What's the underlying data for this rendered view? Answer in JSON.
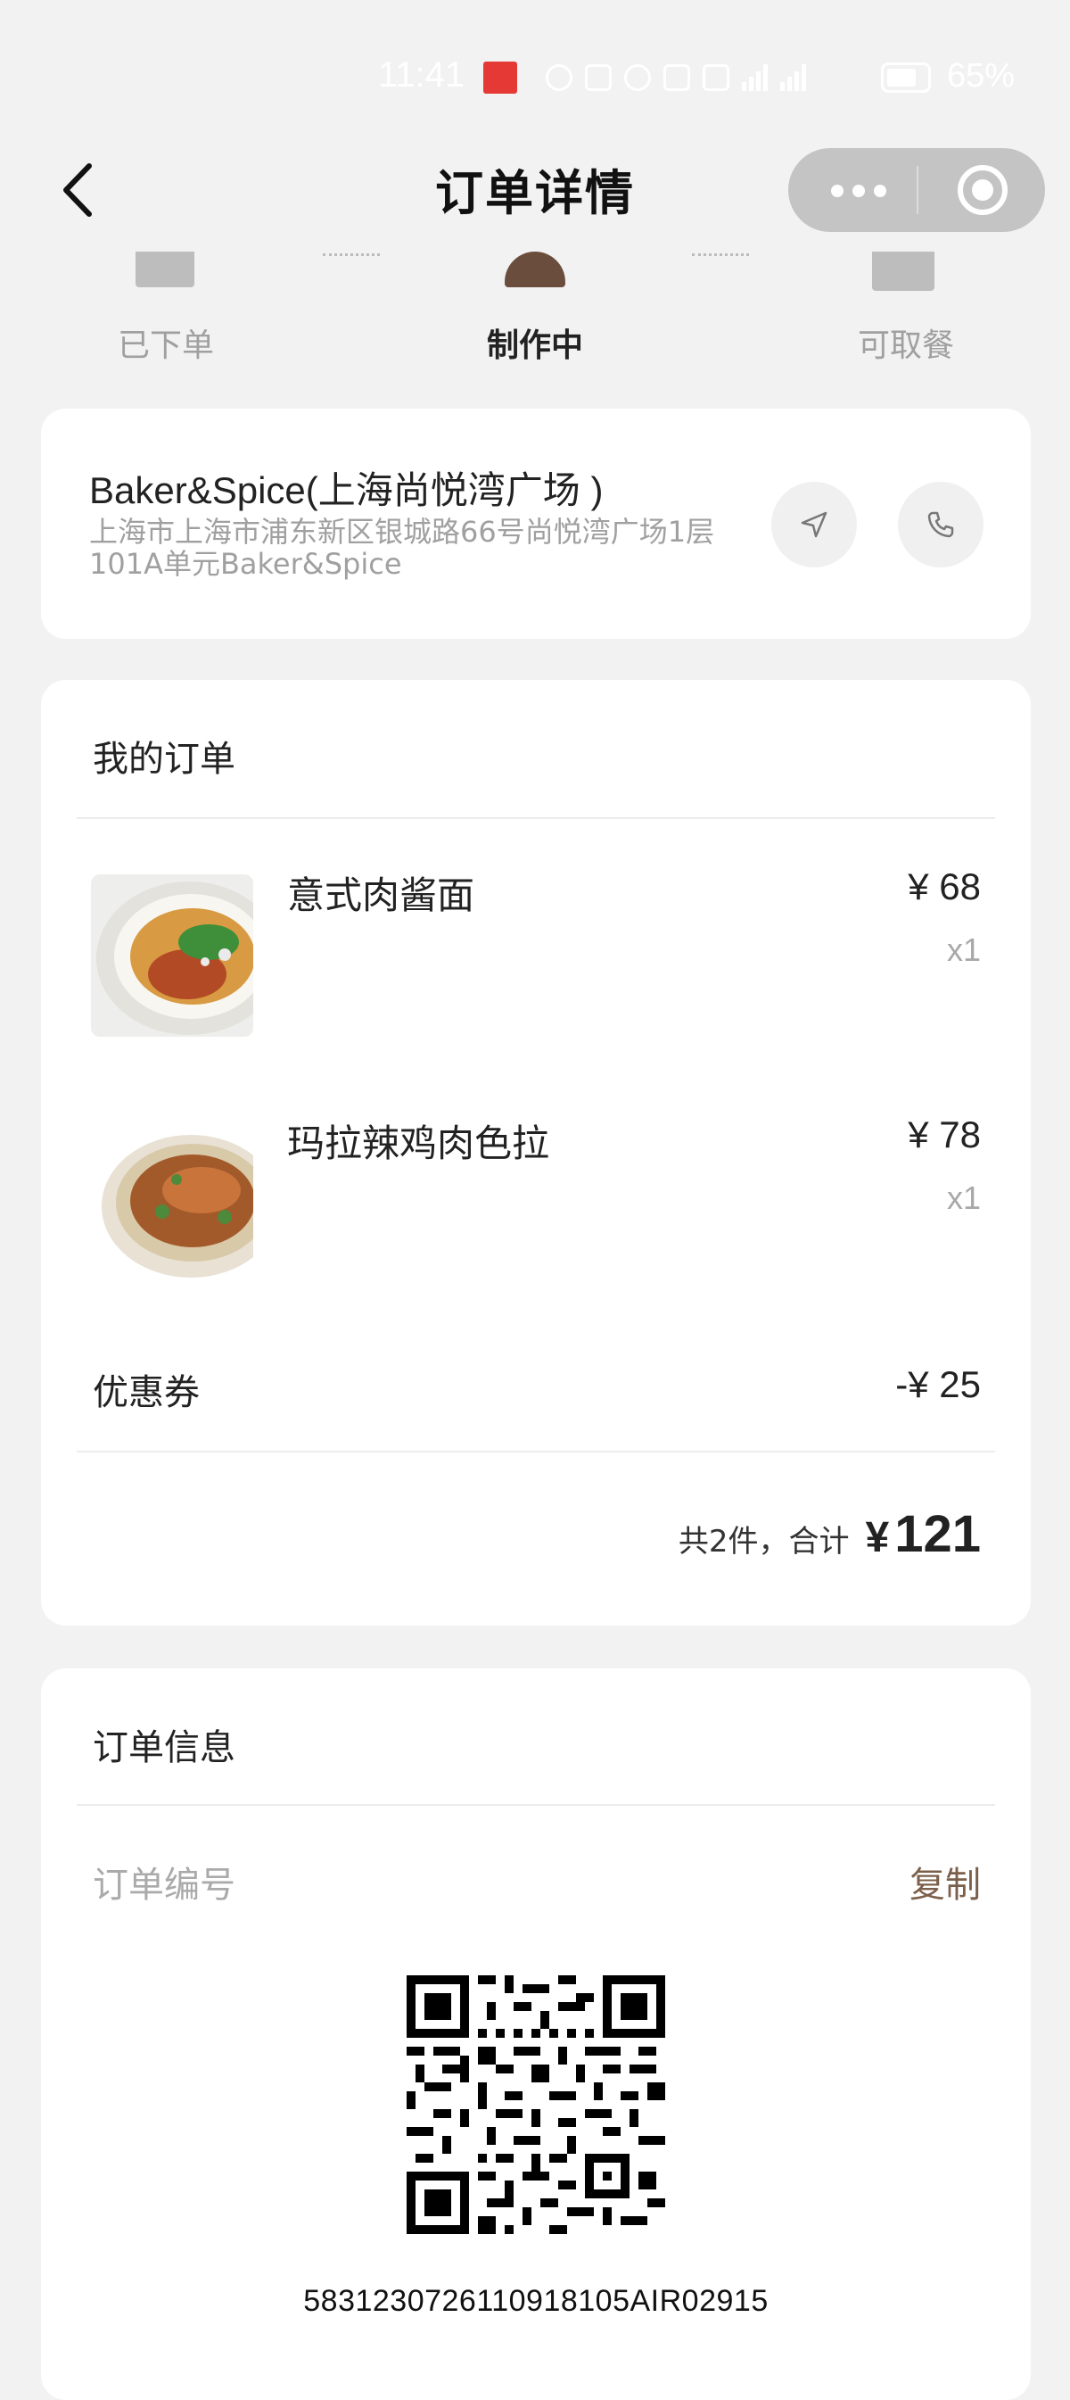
{
  "status_bar": {
    "time": "11:41",
    "battery": "65%"
  },
  "nav": {
    "title": "订单详情"
  },
  "steps": [
    {
      "label": "已下单",
      "active": false
    },
    {
      "label": "制作中",
      "active": true
    },
    {
      "label": "可取餐",
      "active": false
    }
  ],
  "store": {
    "name": "Baker&Spice(上海尚悦湾广场 )",
    "address": "上海市上海市浦东新区银城路66号尚悦湾广场1层101A单元Baker&Spice"
  },
  "order": {
    "section_title": "我的订单",
    "items": [
      {
        "name": "意式肉酱面",
        "price": "¥ 68",
        "qty": "x1"
      },
      {
        "name": "玛拉辣鸡肉色拉",
        "price": "¥ 78",
        "qty": "x1"
      }
    ],
    "coupon_label": "优惠券",
    "coupon_value": "-¥ 25",
    "total_text": "共2件，合计",
    "total_symbol": "¥",
    "total_amount": "121"
  },
  "info": {
    "section_title": "订单信息",
    "order_no_label": "订单编号",
    "copy_label": "复制",
    "order_code": "583123072611091810​5AIR02915"
  },
  "colors": {
    "accent_brown": "#7b5f4a",
    "step_active": "#6b4d3d",
    "step_inactive": "#bdbdbd",
    "background": "#f2f2f2"
  }
}
